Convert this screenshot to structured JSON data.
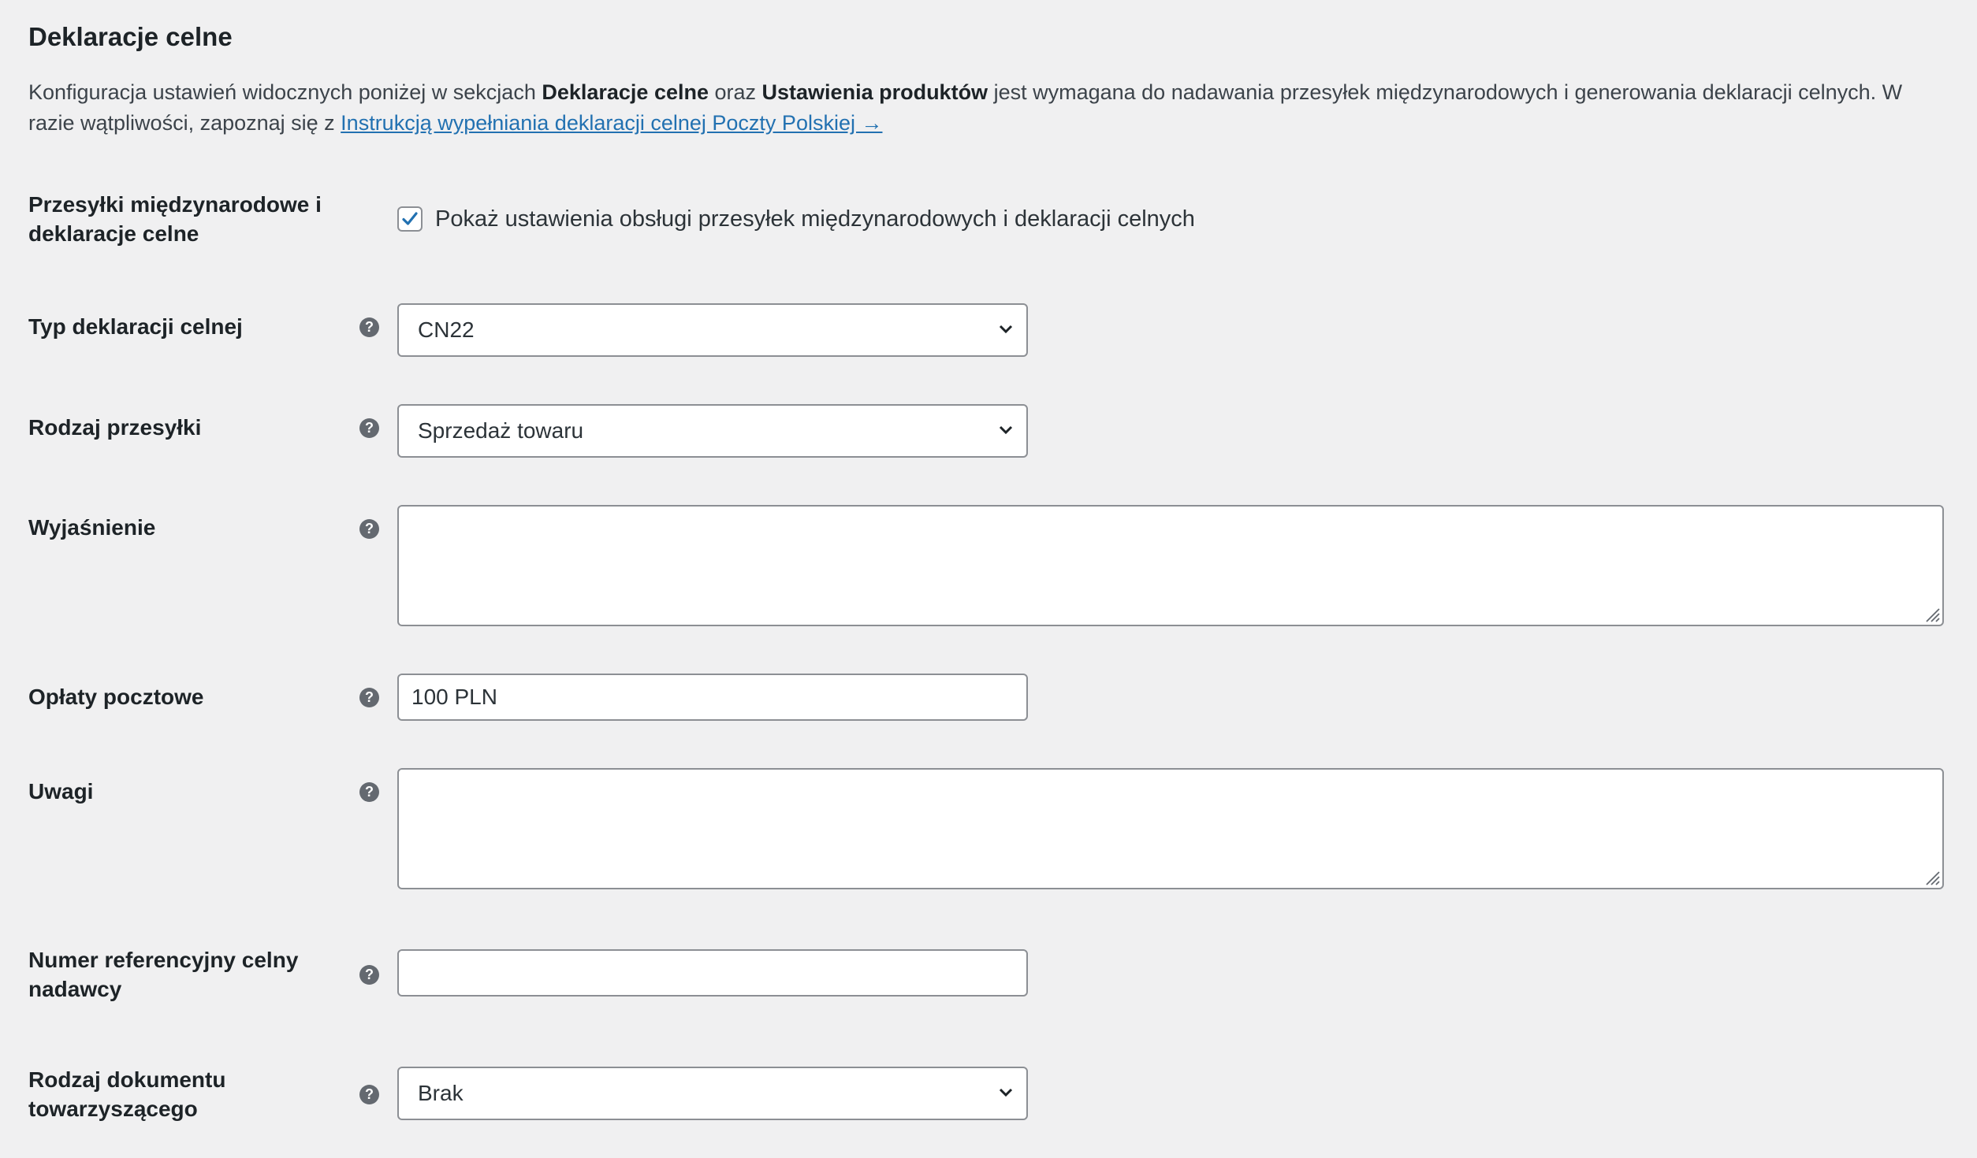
{
  "section": {
    "title": "Deklaracje celne",
    "intro": {
      "text1": "Konfiguracja ustawień widocznych poniżej w sekcjach ",
      "bold1": "Deklaracje celne",
      "text2": " oraz ",
      "bold2": "Ustawienia produktów",
      "text3": " jest wymagana do nadawania przesyłek międzynarodowych i generowania deklaracji celnych. W razie wątpliwości, zapoznaj się z ",
      "link": "Instrukcją wypełniania deklaracji celnej Poczty Polskiej →"
    }
  },
  "fields": {
    "international": {
      "label": "Przesyłki międzynarodowe i deklaracje celne",
      "checkbox_label": "Pokaż ustawienia obsługi przesyłek międzynarodowych i deklaracji celnych",
      "checked": true
    },
    "declaration_type": {
      "label": "Typ deklaracji celnej",
      "value": "CN22"
    },
    "shipment_kind": {
      "label": "Rodzaj przesyłki",
      "value": "Sprzedaż towaru"
    },
    "explanation": {
      "label": "Wyjaśnienie",
      "value": ""
    },
    "postal_fees": {
      "label": "Opłaty pocztowe",
      "value": "100 PLN"
    },
    "notes": {
      "label": "Uwagi",
      "value": ""
    },
    "reference_number": {
      "label": "Numer referencyjny celny nadawcy",
      "value": ""
    },
    "document_type": {
      "label": "Rodzaj dokumentu towarzyszącego",
      "value": "Brak"
    }
  },
  "help_icon_glyph": "?",
  "colors": {
    "accent": "#2271b1",
    "background": "#f0f0f1",
    "text": "#1d2327",
    "border": "#8c8f94"
  }
}
